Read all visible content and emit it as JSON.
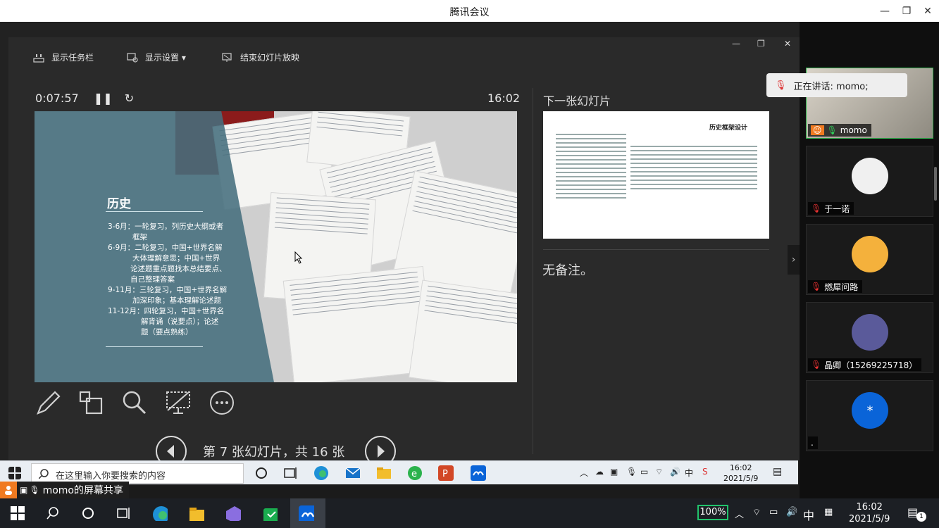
{
  "window": {
    "title": "腾讯会议"
  },
  "presenter": {
    "toolbar": {
      "show_taskbar": "显示任务栏",
      "display_settings": "显示设置 ▾",
      "end_slideshow": "结束幻灯片放映"
    },
    "timer": "0:07:57",
    "clock": "16:02",
    "slide": {
      "title": "历史",
      "plan": [
        {
          "line1": "3-6月：一轮复习，列历史大纲或者",
          "line2": "框架"
        },
        {
          "line1": "6-9月：二轮复习，中国+世界名解",
          "line2": "大体理解意思；中国+世界",
          "line3": "论述题重点题找本总结要点、",
          "line4": "自己整理答案"
        },
        {
          "line1": "9-11月：三轮复习，中国+世界名解",
          "line2": "加深印象；基本理解论述题"
        },
        {
          "line1": "11-12月：四轮复习，中国+世界名",
          "line2": "解背诵（说要点）；论述",
          "line3": "题（要点熟练）"
        }
      ]
    },
    "next_label": "下一张幻灯片",
    "next_slide_title": "历史框架设计",
    "notes": "无备注。",
    "slide_counter": "第 7 张幻灯片，共 16 张"
  },
  "remote_taskbar": {
    "search_placeholder": "在这里输入你要搜索的内容",
    "time": "16:02",
    "date": "2021/5/9"
  },
  "share_label": "momo的屏幕共享",
  "participants": {
    "speaking": "正在讲话: momo;",
    "tiles": [
      {
        "name": "momo"
      },
      {
        "name": "于一诺"
      },
      {
        "name": "燃犀问路"
      },
      {
        "name": "晶卿（15269225718）"
      },
      {
        "name": ".",
        "initial": "*"
      }
    ]
  },
  "local_taskbar": {
    "battery": "100%",
    "ime": "中",
    "time": "16:02",
    "date": "2021/5/9",
    "notification_count": "1"
  },
  "colors": {
    "accent_blue": "#0a64d8",
    "slide_panel": "#466e7d",
    "battery_green": "#21c46c",
    "share_badge": "#f07a20"
  }
}
